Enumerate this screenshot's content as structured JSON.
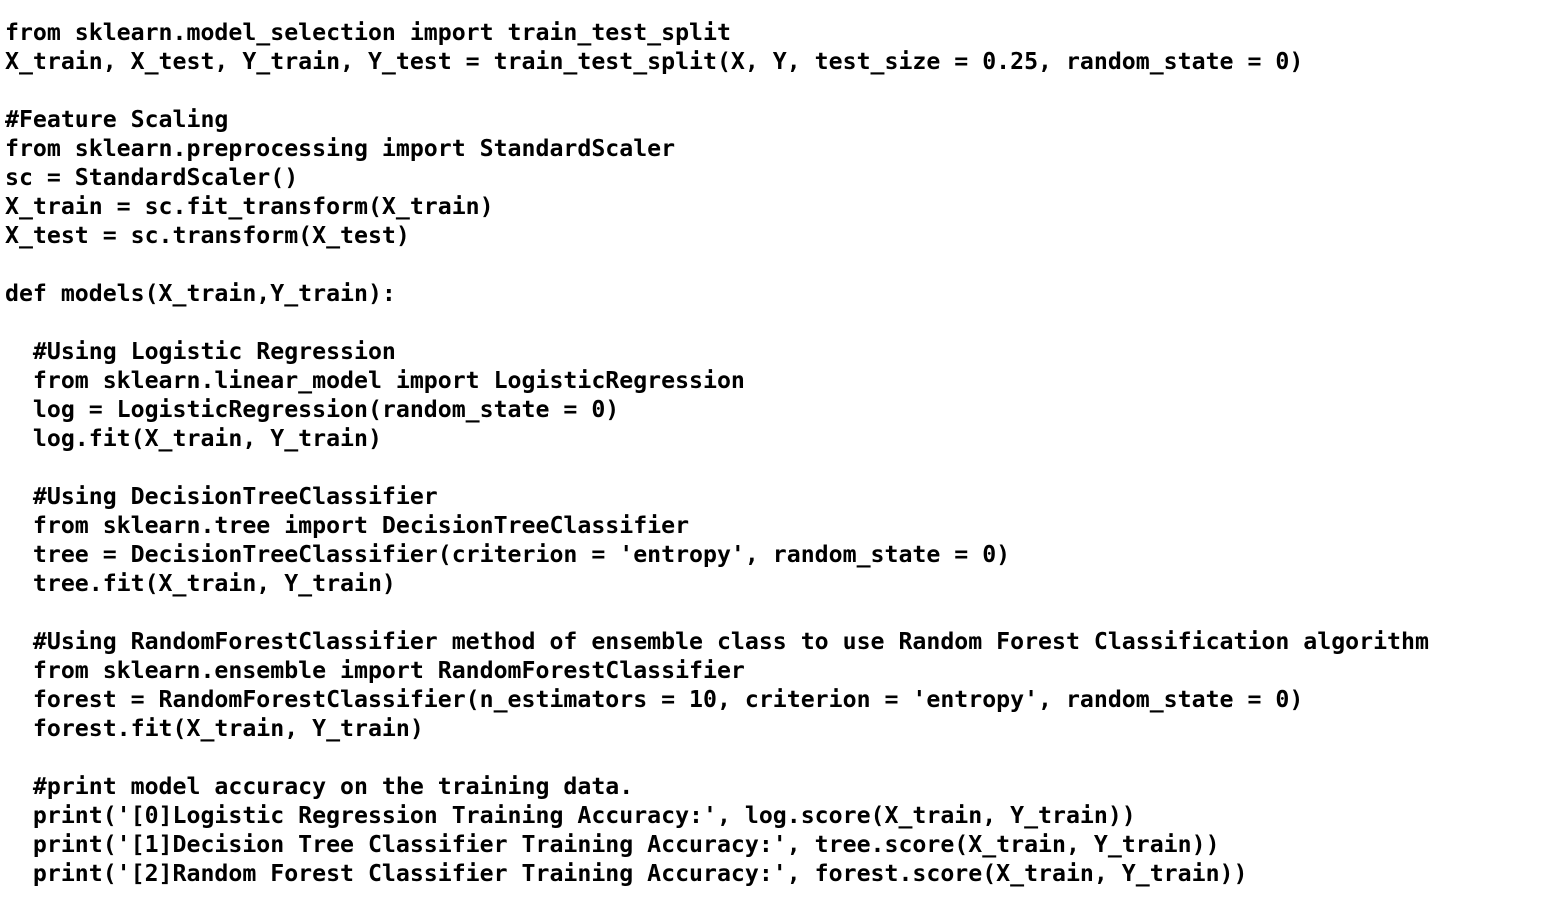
{
  "code": {
    "lines": [
      "from sklearn.model_selection import train_test_split",
      "X_train, X_test, Y_train, Y_test = train_test_split(X, Y, test_size = 0.25, random_state = 0)",
      "",
      "#Feature Scaling",
      "from sklearn.preprocessing import StandardScaler",
      "sc = StandardScaler()",
      "X_train = sc.fit_transform(X_train)",
      "X_test = sc.transform(X_test)",
      "",
      "def models(X_train,Y_train):",
      "",
      "  #Using Logistic Regression",
      "  from sklearn.linear_model import LogisticRegression",
      "  log = LogisticRegression(random_state = 0)",
      "  log.fit(X_train, Y_train)",
      "",
      "  #Using DecisionTreeClassifier",
      "  from sklearn.tree import DecisionTreeClassifier",
      "  tree = DecisionTreeClassifier(criterion = 'entropy', random_state = 0)",
      "  tree.fit(X_train, Y_train)",
      "",
      "  #Using RandomForestClassifier method of ensemble class to use Random Forest Classification algorithm",
      "  from sklearn.ensemble import RandomForestClassifier",
      "  forest = RandomForestClassifier(n_estimators = 10, criterion = 'entropy', random_state = 0)",
      "  forest.fit(X_train, Y_train)",
      "",
      "  #print model accuracy on the training data.",
      "  print('[0]Logistic Regression Training Accuracy:', log.score(X_train, Y_train))",
      "  print('[1]Decision Tree Classifier Training Accuracy:', tree.score(X_train, Y_train))",
      "  print('[2]Random Forest Classifier Training Accuracy:', forest.score(X_train, Y_train))"
    ]
  }
}
